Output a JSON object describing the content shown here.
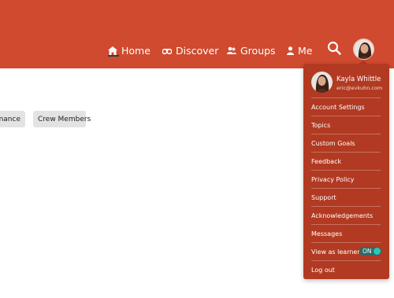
{
  "nav": {
    "home": "Home",
    "discover": "Discover",
    "groups": "Groups",
    "me": "Me"
  },
  "chips": [
    "enance",
    "Crew Members"
  ],
  "profile": {
    "name": "Kayla Whittle",
    "email": "eric@evkuhn.com"
  },
  "menu": {
    "items": [
      "Account Settings",
      "Topics",
      "Custom Goals",
      "Feedback",
      "Privacy Policy",
      "Support",
      "Acknowledgements",
      "Messages",
      "View as learner",
      "Log out"
    ],
    "toggle_label": "ON"
  },
  "colors": {
    "header": "#cf4a2e",
    "menu": "#b23a22",
    "toggle_on": "#2ec4b6"
  },
  "icons": [
    "home-icon",
    "binoculars-icon",
    "groups-icon",
    "person-icon",
    "search-icon"
  ]
}
